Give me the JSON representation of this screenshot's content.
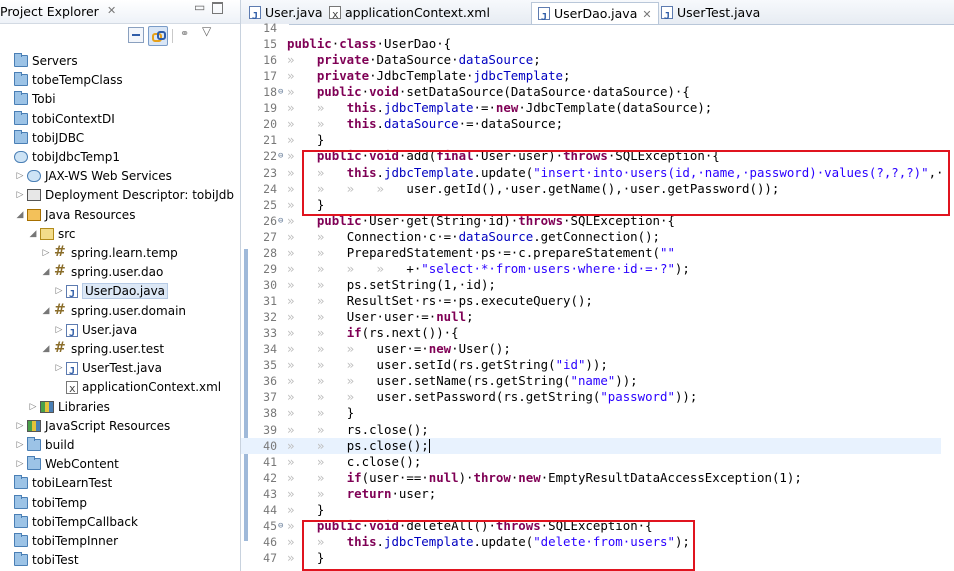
{
  "explorer": {
    "title": "Project Explorer",
    "close_icon": "close-icon",
    "minimize_icon": "minimize-icon",
    "maximize_icon": "maximize-icon",
    "toolbar": [
      "collapse-all-icon",
      "link-with-editor-icon",
      "focus-icon",
      "view-menu-icon"
    ],
    "tree": [
      {
        "label": "Servers",
        "icon": "folder-icon",
        "indent": 0,
        "twisty": ""
      },
      {
        "label": "tobeTempClass",
        "icon": "project-icon",
        "indent": 0,
        "twisty": ""
      },
      {
        "label": "Tobi",
        "icon": "project-icon",
        "indent": 0,
        "twisty": ""
      },
      {
        "label": "tobiContextDI",
        "icon": "project-icon",
        "indent": 0,
        "twisty": ""
      },
      {
        "label": "tobiJDBC",
        "icon": "project-icon",
        "indent": 0,
        "twisty": ""
      },
      {
        "label": "tobiJdbcTemp1",
        "icon": "web-project-icon",
        "indent": 0,
        "twisty": ""
      },
      {
        "label": "JAX-WS Web Services",
        "icon": "web-services-icon",
        "indent": 1,
        "twisty": "▷"
      },
      {
        "label": "Deployment Descriptor: tobiJdb",
        "icon": "deployment-descriptor-icon",
        "indent": 1,
        "twisty": "▷"
      },
      {
        "label": "Java Resources",
        "icon": "java-resources-icon",
        "indent": 1,
        "twisty": "◢"
      },
      {
        "label": "src",
        "icon": "source-folder-icon",
        "indent": 2,
        "twisty": "◢"
      },
      {
        "label": "spring.learn.temp",
        "icon": "package-icon",
        "indent": 3,
        "twisty": "▷"
      },
      {
        "label": "spring.user.dao",
        "icon": "package-icon",
        "indent": 3,
        "twisty": "◢"
      },
      {
        "label": "UserDao.java",
        "icon": "java-file-icon",
        "indent": 4,
        "twisty": "▷",
        "selected": true
      },
      {
        "label": "spring.user.domain",
        "icon": "package-icon",
        "indent": 3,
        "twisty": "◢"
      },
      {
        "label": "User.java",
        "icon": "java-file-icon",
        "indent": 4,
        "twisty": "▷"
      },
      {
        "label": "spring.user.test",
        "icon": "package-icon",
        "indent": 3,
        "twisty": "◢"
      },
      {
        "label": "UserTest.java",
        "icon": "java-file-icon",
        "indent": 4,
        "twisty": "▷"
      },
      {
        "label": "applicationContext.xml",
        "icon": "xml-file-icon",
        "indent": 4,
        "twisty": ""
      },
      {
        "label": "Libraries",
        "icon": "libraries-icon",
        "indent": 2,
        "twisty": "▷"
      },
      {
        "label": "JavaScript Resources",
        "icon": "javascript-resources-icon",
        "indent": 1,
        "twisty": "▷"
      },
      {
        "label": "build",
        "icon": "folder-icon",
        "indent": 1,
        "twisty": "▷"
      },
      {
        "label": "WebContent",
        "icon": "folder-icon",
        "indent": 1,
        "twisty": "▷"
      },
      {
        "label": "tobiLearnTest",
        "icon": "project-icon",
        "indent": 0,
        "twisty": ""
      },
      {
        "label": "tobiTemp",
        "icon": "project-icon",
        "indent": 0,
        "twisty": ""
      },
      {
        "label": "tobiTempCallback",
        "icon": "project-icon",
        "indent": 0,
        "twisty": ""
      },
      {
        "label": "tobiTempInner",
        "icon": "project-icon",
        "indent": 0,
        "twisty": ""
      },
      {
        "label": "tobiTest",
        "icon": "project-icon",
        "indent": 0,
        "twisty": ""
      }
    ]
  },
  "editor": {
    "tabs": [
      {
        "label": "User.java",
        "icon": "java-file-icon",
        "active": false
      },
      {
        "label": "applicationContext.xml",
        "icon": "xml-file-icon",
        "active": false
      },
      {
        "label": "UserDao.java",
        "icon": "java-file-icon",
        "active": true
      },
      {
        "label": "UserTest.java",
        "icon": "java-file-icon",
        "active": false
      }
    ],
    "close_icon": "close-icon",
    "highlight_color": "#e0141f",
    "lines": [
      {
        "n": "14",
        "fold": "",
        "segs": []
      },
      {
        "n": "15",
        "fold": "",
        "segs": [
          [
            "kw",
            "public"
          ],
          [
            "",
            "·"
          ],
          [
            "kw",
            "class"
          ],
          [
            "",
            "·UserDao·{"
          ]
        ]
      },
      {
        "n": "16",
        "fold": "",
        "segs": [
          [
            "dim",
            "»   "
          ],
          [
            "kw",
            "private"
          ],
          [
            "",
            "·DataSource·"
          ],
          [
            "fd",
            "dataSource"
          ],
          [
            "",
            ";"
          ]
        ]
      },
      {
        "n": "17",
        "fold": "",
        "segs": [
          [
            "dim",
            "»   "
          ],
          [
            "kw",
            "private"
          ],
          [
            "",
            "·JdbcTemplate·"
          ],
          [
            "fd",
            "jdbcTemplate"
          ],
          [
            "",
            ";"
          ]
        ]
      },
      {
        "n": "18",
        "fold": "⊖",
        "segs": [
          [
            "dim",
            "»   "
          ],
          [
            "kw",
            "public"
          ],
          [
            "",
            "·"
          ],
          [
            "kw",
            "void"
          ],
          [
            "",
            "·setDataSource(DataSource·dataSource)·{"
          ]
        ]
      },
      {
        "n": "19",
        "fold": "",
        "segs": [
          [
            "dim",
            "»   »   "
          ],
          [
            "kw",
            "this"
          ],
          [
            "",
            "."
          ],
          [
            "fd",
            "jdbcTemplate"
          ],
          [
            "",
            "·=·"
          ],
          [
            "kw",
            "new"
          ],
          [
            "",
            "·JdbcTemplate(dataSource);"
          ]
        ]
      },
      {
        "n": "20",
        "fold": "",
        "segs": [
          [
            "dim",
            "»   »   "
          ],
          [
            "kw",
            "this"
          ],
          [
            "",
            "."
          ],
          [
            "fd",
            "dataSource"
          ],
          [
            "",
            "·=·dataSource;"
          ]
        ]
      },
      {
        "n": "21",
        "fold": "",
        "segs": [
          [
            "dim",
            "»   "
          ],
          [
            "",
            "}"
          ]
        ]
      },
      {
        "n": "22",
        "fold": "⊖",
        "segs": [
          [
            "dim",
            "»   "
          ],
          [
            "kw",
            "public"
          ],
          [
            "",
            "·"
          ],
          [
            "kw",
            "void"
          ],
          [
            "",
            "·add("
          ],
          [
            "kw",
            "final"
          ],
          [
            "",
            "·User·user)·"
          ],
          [
            "kw",
            "throws"
          ],
          [
            "",
            "·SQLException·{"
          ]
        ]
      },
      {
        "n": "23",
        "fold": "",
        "segs": [
          [
            "dim",
            "»   »   "
          ],
          [
            "kw",
            "this"
          ],
          [
            "",
            "."
          ],
          [
            "fd",
            "jdbcTemplate"
          ],
          [
            "",
            ".update("
          ],
          [
            "str",
            "\"insert·into·users(id,·name,·password)·values(?,?,?)\""
          ],
          [
            "",
            ",·"
          ]
        ]
      },
      {
        "n": "24",
        "fold": "",
        "segs": [
          [
            "dim",
            "»   »   »   »   "
          ],
          [
            "",
            "user.getId(),·user.getName(),·user.getPassword());"
          ]
        ]
      },
      {
        "n": "25",
        "fold": "",
        "segs": [
          [
            "dim",
            "»   "
          ],
          [
            "",
            "}"
          ]
        ]
      },
      {
        "n": "26",
        "fold": "⊖",
        "segs": [
          [
            "dim",
            "»   "
          ],
          [
            "kw",
            "public"
          ],
          [
            "",
            "·User·get(String·id)·"
          ],
          [
            "kw",
            "throws"
          ],
          [
            "",
            "·SQLException·{"
          ]
        ]
      },
      {
        "n": "27",
        "fold": "",
        "segs": [
          [
            "dim",
            "»   »   "
          ],
          [
            "",
            "Connection·c·=·"
          ],
          [
            "fd",
            "dataSource"
          ],
          [
            "",
            ".getConnection();"
          ]
        ]
      },
      {
        "n": "28",
        "fold": "",
        "segs": [
          [
            "dim",
            "»   »   "
          ],
          [
            "",
            "PreparedStatement·ps·=·c.prepareStatement("
          ],
          [
            "str",
            "\"\""
          ]
        ]
      },
      {
        "n": "29",
        "fold": "",
        "segs": [
          [
            "dim",
            "»   »   »   »   "
          ],
          [
            "",
            "+·"
          ],
          [
            "str",
            "\"select·*·from·users·where·id·=·?\""
          ],
          [
            "",
            ");"
          ]
        ]
      },
      {
        "n": "30",
        "fold": "",
        "segs": [
          [
            "dim",
            "»   »   "
          ],
          [
            "",
            "ps.setString(1,·id);"
          ]
        ]
      },
      {
        "n": "31",
        "fold": "",
        "segs": [
          [
            "dim",
            "»   »   "
          ],
          [
            "",
            "ResultSet·rs·=·ps.executeQuery();"
          ]
        ]
      },
      {
        "n": "32",
        "fold": "",
        "segs": [
          [
            "dim",
            "»   »   "
          ],
          [
            "",
            "User·user·=·"
          ],
          [
            "kw",
            "null"
          ],
          [
            "",
            ";"
          ]
        ]
      },
      {
        "n": "33",
        "fold": "",
        "segs": [
          [
            "dim",
            "»   »   "
          ],
          [
            "kw",
            "if"
          ],
          [
            "",
            "(rs.next())·{"
          ]
        ]
      },
      {
        "n": "34",
        "fold": "",
        "segs": [
          [
            "dim",
            "»   »   »   "
          ],
          [
            "",
            "user·=·"
          ],
          [
            "kw",
            "new"
          ],
          [
            "",
            "·User();"
          ]
        ]
      },
      {
        "n": "35",
        "fold": "",
        "segs": [
          [
            "dim",
            "»   »   »   "
          ],
          [
            "",
            "user.setId(rs.getString("
          ],
          [
            "str",
            "\"id\""
          ],
          [
            "",
            "));"
          ]
        ]
      },
      {
        "n": "36",
        "fold": "",
        "segs": [
          [
            "dim",
            "»   »   »   "
          ],
          [
            "",
            "user.setName(rs.getString("
          ],
          [
            "str",
            "\"name\""
          ],
          [
            "",
            "));"
          ]
        ]
      },
      {
        "n": "37",
        "fold": "",
        "segs": [
          [
            "dim",
            "»   »   »   "
          ],
          [
            "",
            "user.setPassword(rs.getString("
          ],
          [
            "str",
            "\"password\""
          ],
          [
            "",
            "));"
          ]
        ]
      },
      {
        "n": "38",
        "fold": "",
        "segs": [
          [
            "dim",
            "»   »   "
          ],
          [
            "",
            "}"
          ]
        ]
      },
      {
        "n": "39",
        "fold": "",
        "segs": [
          [
            "dim",
            "»   »   "
          ],
          [
            "",
            "rs.close();"
          ]
        ]
      },
      {
        "n": "40",
        "fold": "",
        "segs": [
          [
            "dim",
            "»   »   "
          ],
          [
            "",
            "ps.close();"
          ]
        ],
        "current": true
      },
      {
        "n": "41",
        "fold": "",
        "segs": [
          [
            "dim",
            "»   »   "
          ],
          [
            "",
            "c.close();"
          ]
        ]
      },
      {
        "n": "42",
        "fold": "",
        "segs": [
          [
            "dim",
            "»   »   "
          ],
          [
            "kw",
            "if"
          ],
          [
            "",
            "(user·==·"
          ],
          [
            "kw",
            "null"
          ],
          [
            "",
            ")·"
          ],
          [
            "kw",
            "throw"
          ],
          [
            "",
            "·"
          ],
          [
            "kw",
            "new"
          ],
          [
            "",
            "·EmptyResultDataAccessException(1);"
          ]
        ]
      },
      {
        "n": "43",
        "fold": "",
        "segs": [
          [
            "dim",
            "»   »   "
          ],
          [
            "kw",
            "return"
          ],
          [
            "",
            "·user;"
          ]
        ]
      },
      {
        "n": "44",
        "fold": "",
        "segs": [
          [
            "dim",
            "»   "
          ],
          [
            "",
            "}"
          ]
        ]
      },
      {
        "n": "45",
        "fold": "⊖",
        "segs": [
          [
            "dim",
            "»   "
          ],
          [
            "kw",
            "public"
          ],
          [
            "",
            "·"
          ],
          [
            "kw",
            "void"
          ],
          [
            "",
            "·deleteAll()·"
          ],
          [
            "kw",
            "throws"
          ],
          [
            "",
            "·SQLException·{"
          ]
        ]
      },
      {
        "n": "46",
        "fold": "",
        "segs": [
          [
            "dim",
            "»   »   "
          ],
          [
            "kw",
            "this"
          ],
          [
            "",
            "."
          ],
          [
            "fd",
            "jdbcTemplate"
          ],
          [
            "",
            ".update("
          ],
          [
            "str",
            "\"delete·from·users\""
          ],
          [
            "",
            ");"
          ]
        ]
      },
      {
        "n": "47",
        "fold": "",
        "segs": [
          [
            "dim",
            "»   "
          ],
          [
            "",
            "}"
          ]
        ]
      }
    ]
  }
}
